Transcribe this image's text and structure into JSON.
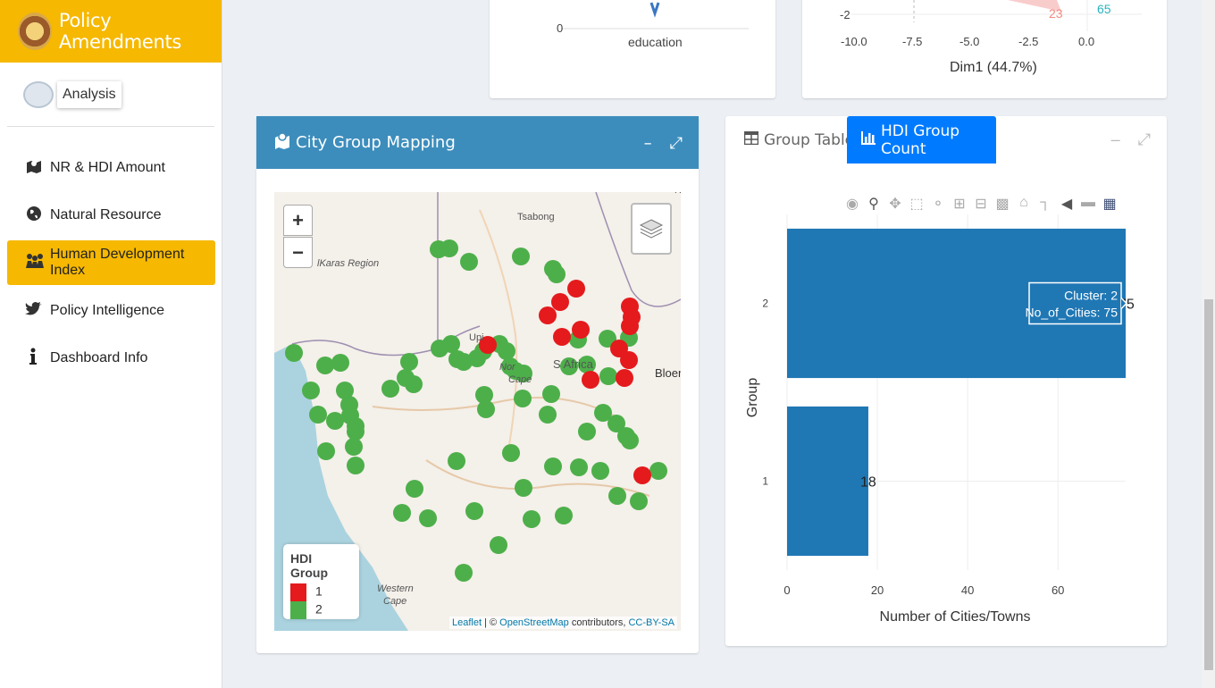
{
  "brand": {
    "title": "Policy Amendments"
  },
  "sidebar": {
    "analysis_label": "Analysis",
    "items": [
      {
        "label": "NR & HDI Amount",
        "icon": "map-pin-icon"
      },
      {
        "label": "Natural Resource",
        "icon": "globe-icon"
      },
      {
        "label": "Human Development Index",
        "icon": "users-icon"
      },
      {
        "label": "Policy Intelligence",
        "icon": "twitter-icon"
      },
      {
        "label": "Dashboard Info",
        "icon": "info-icon"
      }
    ],
    "active_index": 2
  },
  "top_left_chart": {
    "tick": "0",
    "label": "education"
  },
  "top_right_chart": {
    "ytick": "-2",
    "xticks": [
      "-10.0",
      "-7.5",
      "-5.0",
      "-2.5",
      "0.0"
    ],
    "xlabel": "Dim1 (44.7%)",
    "point_labels": [
      "23",
      "65"
    ]
  },
  "map_box": {
    "title": "City Group Mapping",
    "zoom_in": "+",
    "zoom_out": "−",
    "legend": {
      "title": "HDI Group",
      "entries": [
        {
          "label": "1",
          "color": "#e41a1c"
        },
        {
          "label": "2",
          "color": "#4daf4a"
        }
      ]
    },
    "labels": {
      "tsabong": "Tsabong",
      "karas": "lKaras Region",
      "upington": "Upi",
      "ncape1": "Nor",
      "ncape2": "Cape",
      "southafrica": "S   Africa",
      "bloem": "Bloer",
      "wcape1": "Western",
      "wcape2": "Cape",
      "ra": "Ra"
    },
    "attribution": {
      "leaflet": "Leaflet",
      "sep": " | © ",
      "osm": "OpenStreetMap",
      "contrib": " contributors, ",
      "license": "CC-BY-SA"
    }
  },
  "group_box": {
    "tabs": [
      {
        "label": "Group Table"
      },
      {
        "label": "HDI Group Count"
      }
    ],
    "active_tab": 1
  },
  "chart_data": {
    "type": "bar",
    "orientation": "horizontal",
    "categories": [
      "1",
      "2"
    ],
    "values": [
      18,
      75
    ],
    "xlabel": "Number of Cities/Towns",
    "ylabel": "Group",
    "xlim": [
      0,
      75
    ],
    "xticks": [
      0,
      20,
      40,
      60
    ],
    "color": "#1f77b4",
    "data_labels": [
      "18",
      "75"
    ],
    "hover": {
      "line1": "Cluster: 2",
      "line2": "No_of_Cities: 75"
    }
  }
}
